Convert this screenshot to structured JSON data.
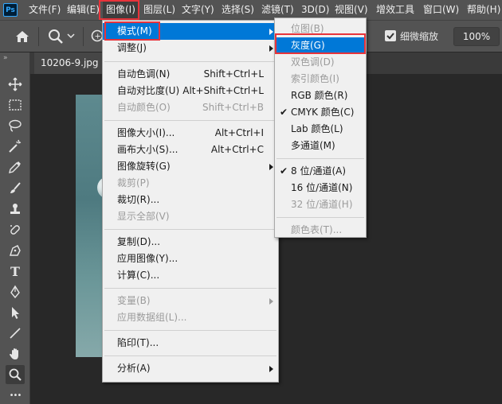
{
  "app": {
    "logo": "Ps"
  },
  "menubar": {
    "items": [
      "文件(F)",
      "编辑(E)",
      "图像(I)",
      "图层(L)",
      "文字(Y)",
      "选择(S)",
      "滤镜(T)",
      "3D(D)",
      "视图(V)",
      "增效工具",
      "窗口(W)",
      "帮助(H)"
    ],
    "active_index": 2
  },
  "options_bar": {
    "scrubby_zoom_label": "细微缩放",
    "scrubby_zoom_checked": true,
    "zoom_value": "100%",
    "zoom_in_symbol": "+"
  },
  "document": {
    "tab_label": "10206-9.jpg @"
  },
  "image_menu": {
    "groups": [
      [
        {
          "label": "模式(M)",
          "shortcut": "",
          "submenu": true,
          "highlighted": true,
          "disabled": false
        },
        {
          "label": "调整(J)",
          "shortcut": "",
          "submenu": true,
          "disabled": false
        }
      ],
      [
        {
          "label": "自动色调(N)",
          "shortcut": "Shift+Ctrl+L",
          "disabled": false
        },
        {
          "label": "自动对比度(U)",
          "shortcut": "Alt+Shift+Ctrl+L",
          "disabled": false
        },
        {
          "label": "自动颜色(O)",
          "shortcut": "Shift+Ctrl+B",
          "disabled": true
        }
      ],
      [
        {
          "label": "图像大小(I)...",
          "shortcut": "Alt+Ctrl+I",
          "disabled": false
        },
        {
          "label": "画布大小(S)...",
          "shortcut": "Alt+Ctrl+C",
          "disabled": false
        },
        {
          "label": "图像旋转(G)",
          "shortcut": "",
          "submenu": true,
          "disabled": false
        },
        {
          "label": "裁剪(P)",
          "shortcut": "",
          "disabled": true
        },
        {
          "label": "裁切(R)...",
          "shortcut": "",
          "disabled": false
        },
        {
          "label": "显示全部(V)",
          "shortcut": "",
          "disabled": true
        }
      ],
      [
        {
          "label": "复制(D)...",
          "shortcut": "",
          "disabled": false
        },
        {
          "label": "应用图像(Y)...",
          "shortcut": "",
          "disabled": false
        },
        {
          "label": "计算(C)...",
          "shortcut": "",
          "disabled": false
        }
      ],
      [
        {
          "label": "变量(B)",
          "shortcut": "",
          "submenu": true,
          "disabled": true
        },
        {
          "label": "应用数据组(L)...",
          "shortcut": "",
          "disabled": true
        }
      ],
      [
        {
          "label": "陷印(T)...",
          "shortcut": "",
          "disabled": false
        }
      ],
      [
        {
          "label": "分析(A)",
          "shortcut": "",
          "submenu": true,
          "disabled": false
        }
      ]
    ]
  },
  "mode_submenu": {
    "groups": [
      [
        {
          "label": "位图(B)",
          "disabled": true
        },
        {
          "label": "灰度(G)",
          "highlighted": true
        },
        {
          "label": "双色调(D)",
          "disabled": true
        },
        {
          "label": "索引颜色(I)",
          "disabled": true
        },
        {
          "label": "RGB 颜色(R)"
        },
        {
          "label": "CMYK 颜色(C)",
          "checked": true
        },
        {
          "label": "Lab 颜色(L)"
        },
        {
          "label": "多通道(M)"
        }
      ],
      [
        {
          "label": "8 位/通道(A)",
          "checked": true
        },
        {
          "label": "16 位/通道(N)"
        },
        {
          "label": "32 位/通道(H)",
          "disabled": true
        }
      ],
      [
        {
          "label": "颜色表(T)...",
          "disabled": true
        }
      ]
    ],
    "check_glyph": "✔"
  },
  "toolbar": {
    "tools": [
      "move-tool-icon",
      "marquee-tool-icon",
      "lasso-tool-icon",
      "magic-wand-icon",
      "eyedropper-icon",
      "brush-icon",
      "stamp-icon",
      "healing-icon",
      "pen-tool-icon",
      "type-tool-icon",
      "pen-icon",
      "path-select-icon",
      "line-tool-icon",
      "hand-tool-icon",
      "zoom-tool-icon",
      "more-tools-icon"
    ],
    "selected": "zoom-tool-icon",
    "type_glyph": "T",
    "more_glyph": "•••",
    "collapse_glyph": "»"
  }
}
